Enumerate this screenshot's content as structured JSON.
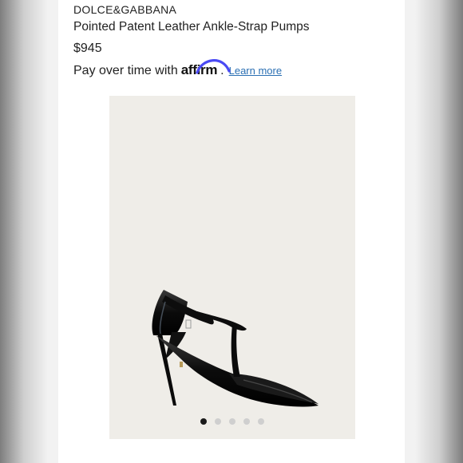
{
  "product": {
    "brand": "DOLCE&GABBANA",
    "title": "Pointed Patent Leather Ankle-Strap Pumps",
    "price": "$945"
  },
  "financing": {
    "text": "Pay over time with",
    "provider_logo": "affirm",
    "provider_suffix": ".",
    "learn_more": "Learn more"
  },
  "gallery": {
    "image_icon": "black-patent-ankle-strap-pump",
    "background_color": "#efede8",
    "total_images": 5,
    "active_index": 0
  }
}
